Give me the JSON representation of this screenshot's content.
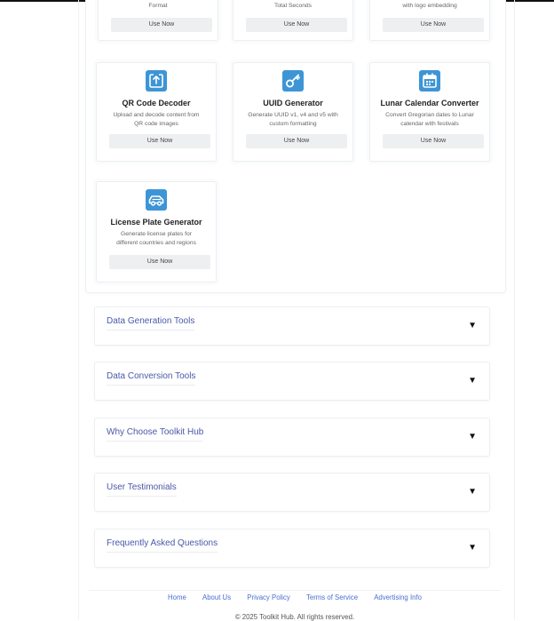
{
  "partial_cards": [
    {
      "text": "Format",
      "button": "Use Now"
    },
    {
      "text": "Total Seconds",
      "button": "Use Now"
    },
    {
      "text": "with logo embedding",
      "button": "Use Now"
    }
  ],
  "cards": [
    {
      "icon": "upload-icon",
      "title": "QR Code Decoder",
      "desc_1": "Upload and decode content from",
      "desc_2": "QR code images",
      "button": "Use Now"
    },
    {
      "icon": "key-icon",
      "title": "UUID Generator",
      "desc_1": "Generate UUID v1, v4 and v5 with",
      "desc_2": "custom formatting",
      "button": "Use Now"
    },
    {
      "icon": "calendar-icon",
      "title": "Lunar Calendar Converter",
      "desc_1": "Convert Gregorian dates to Lunar",
      "desc_2": "calendar with festivals",
      "button": "Use Now"
    },
    {
      "icon": "car-icon",
      "title": "License Plate Generator",
      "desc_1": "Generate license plates for",
      "desc_2": "different countries and regions",
      "button": "Use Now"
    }
  ],
  "accordion": [
    {
      "label": "Data Generation Tools",
      "arrow": "▼"
    },
    {
      "label": "Data Conversion Tools",
      "arrow": "▼"
    },
    {
      "label": "Why Choose Toolkit Hub",
      "arrow": "▼"
    },
    {
      "label": "User Testimonials",
      "arrow": "▼"
    },
    {
      "label": "Frequently Asked Questions",
      "arrow": "▼"
    }
  ],
  "footer": {
    "links": [
      "Home",
      "About Us",
      "Privacy Policy",
      "Terms of Service",
      "Advertising Info"
    ],
    "copyright": "© 2025 Toolkit Hub. All rights reserved."
  },
  "colors": {
    "icon_bg": "#3d95d6",
    "accordion_text": "#4a58a8",
    "footer_link": "#4a6fd0"
  }
}
